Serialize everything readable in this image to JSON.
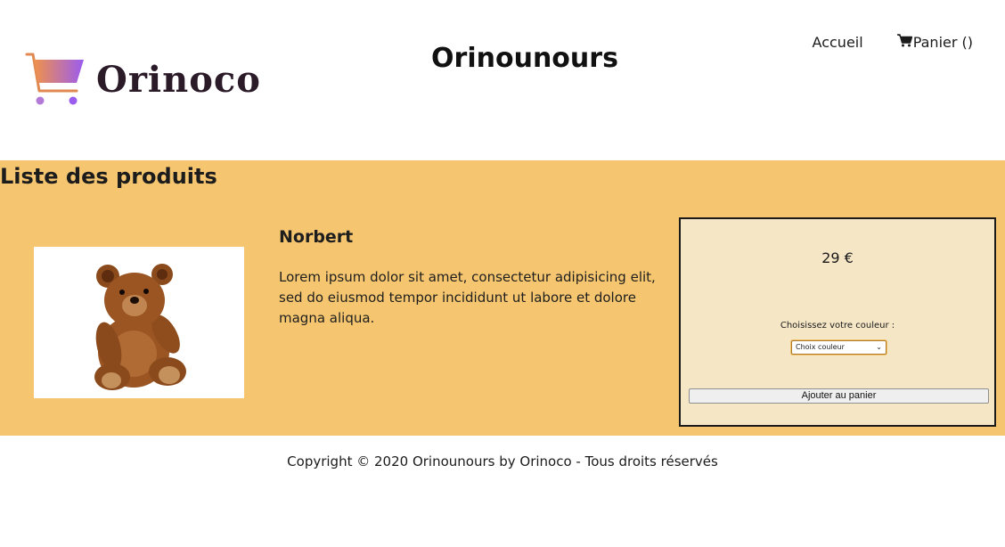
{
  "header": {
    "logo_text": "Orinoco",
    "title": "Orinounours",
    "nav": {
      "home_label": "Accueil",
      "cart_label": "Panier ()"
    }
  },
  "main": {
    "section_title": "Liste des produits",
    "product": {
      "name": "Norbert",
      "description": "Lorem ipsum dolor sit amet, consectetur adipisicing elit, sed do eiusmod tempor incididunt ut labore et dolore magna aliqua.",
      "price": "29 €",
      "color_label": "Choisissez votre couleur :",
      "color_select_value": "Choix couleur",
      "add_button_label": "Ajouter au panier"
    }
  },
  "footer": {
    "copyright": "Copyright © 2020 Orinounours by Orinoco - Tous droits réservés"
  },
  "colors": {
    "band": "#f5c66f",
    "panel": "#f5e6c6",
    "logo_gradient_start": "#f0924a",
    "logo_gradient_end": "#9b5cf0"
  },
  "icons": {
    "logo": "shopping-cart-icon",
    "cart_nav": "cart-icon",
    "select": "chevron-down-icon"
  }
}
